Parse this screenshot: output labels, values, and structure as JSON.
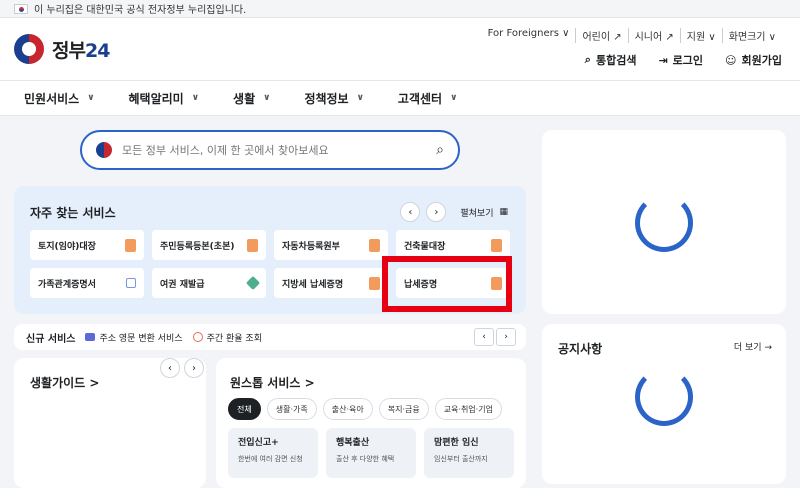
{
  "gov_banner": "이 누리집은 대한민국 공식 전자정부 누리집입니다.",
  "logo": {
    "text": "정부",
    "num": "24"
  },
  "util_nav": [
    "For Foreigners ∨",
    "어린이 ↗",
    "시니어 ↗",
    "지원 ∨",
    "화면크기 ∨"
  ],
  "actions": {
    "search": "통합검색",
    "login": "로그인",
    "signup": "회원가입"
  },
  "gnb": [
    "민원서비스",
    "혜택알리미",
    "생활",
    "정책정보",
    "고객센터"
  ],
  "search": {
    "placeholder": "모든 정부 서비스, 이제 한 곳에서 찾아보세요"
  },
  "favorites": {
    "title": "자주 찾는 서비스",
    "expand": "펼쳐보기",
    "tiles": [
      "토지(임야)대장",
      "주민등록등본(초본)",
      "자동차등록원부",
      "건축물대장",
      "가족관계증명서",
      "여권 재발급",
      "지방세 납세증명",
      "납세증명"
    ]
  },
  "new_services": {
    "label": "신규 서비스",
    "items": [
      "주소 영문 변환 서비스",
      "주간 환율 조회"
    ]
  },
  "guide": {
    "title": "생활가이드 >"
  },
  "one_stop": {
    "title": "원스톱 서비스 >",
    "chips": [
      "전체",
      "생활·가족",
      "출산·육아",
      "복지·금융",
      "교육·취업·기업"
    ],
    "cards": [
      {
        "title": "전입신고+",
        "desc": "한번에 여러 감면 신청"
      },
      {
        "title": "행복출산",
        "desc": "출산 후 다양한 혜택"
      },
      {
        "title": "맘편한 임신",
        "desc": "임신부터 출산까지"
      }
    ]
  },
  "notice": {
    "title": "공지사항",
    "more": "더 보기 →"
  },
  "colors": {
    "accent": "#2b64c9",
    "highlight": "#e60012"
  }
}
